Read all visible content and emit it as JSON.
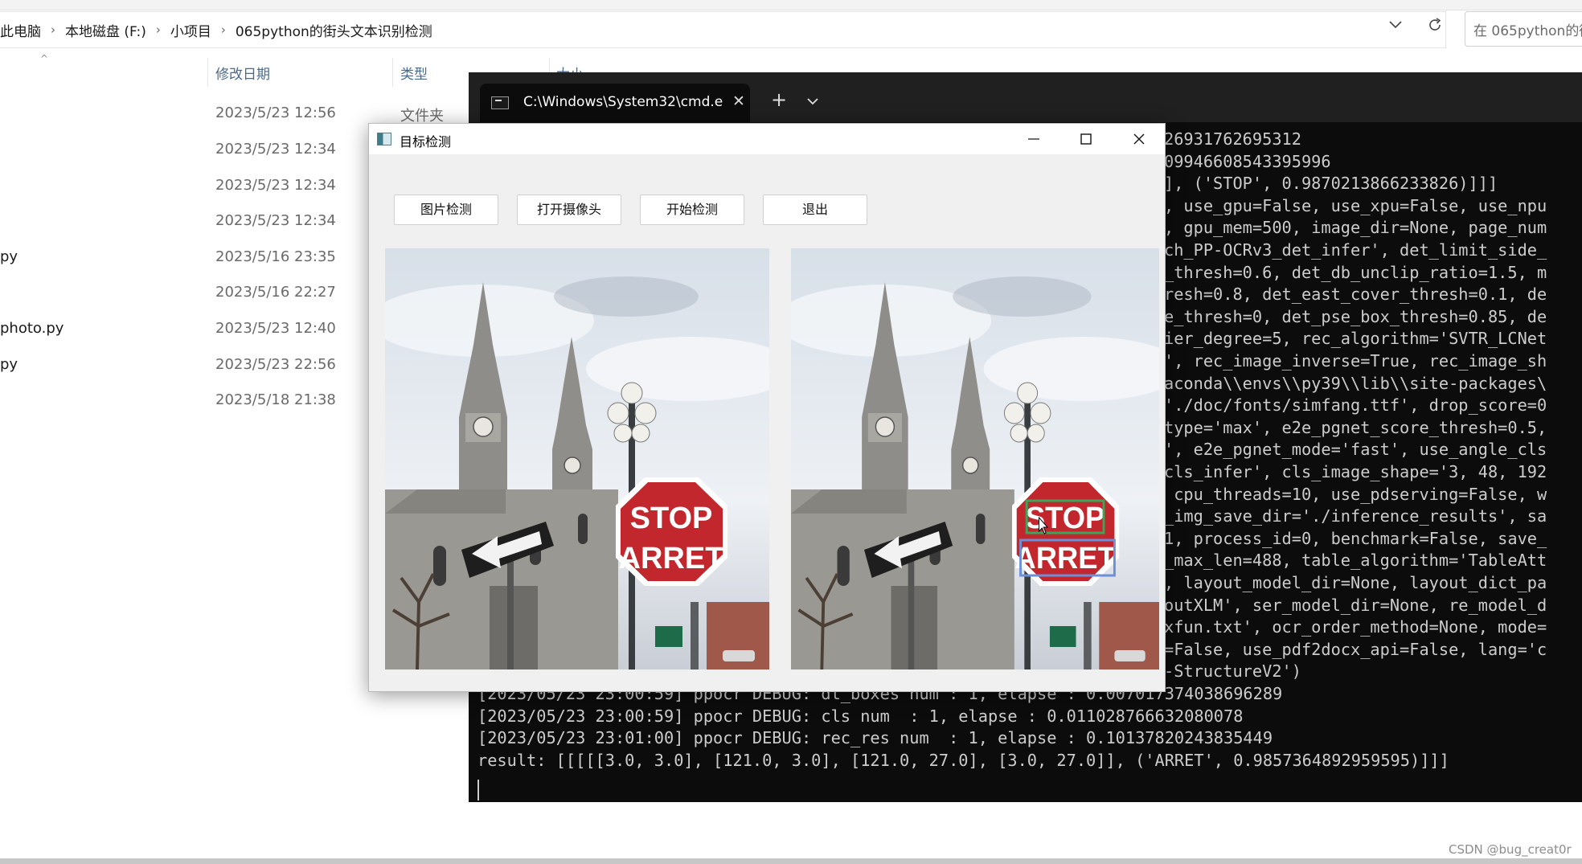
{
  "explorer": {
    "breadcrumb": [
      "此电脑",
      "本地磁盘 (F:)",
      "小项目",
      "065python的街头文本识别检测"
    ],
    "search_placeholder": "在 065python的街",
    "columns": {
      "date": "修改日期",
      "type": "类型",
      "size": "大小"
    },
    "rows": [
      {
        "name": "",
        "date": "2023/5/23 12:56",
        "type": "文件夹"
      },
      {
        "name": "",
        "date": "2023/5/23 12:34",
        "type": ""
      },
      {
        "name": "",
        "date": "2023/5/23 12:34",
        "type": ""
      },
      {
        "name": "",
        "date": "2023/5/23 12:34",
        "type": ""
      },
      {
        "name": "py",
        "date": "2023/5/16 23:35",
        "type": ""
      },
      {
        "name": "",
        "date": "2023/5/16 22:27",
        "type": ""
      },
      {
        "name": "photo.py",
        "date": "2023/5/23 12:40",
        "type": ""
      },
      {
        "name": "py",
        "date": "2023/5/23 22:56",
        "type": ""
      },
      {
        "name": "",
        "date": "2023/5/18 21:38",
        "type": ""
      }
    ]
  },
  "terminal": {
    "tab_title": "C:\\Windows\\System32\\cmd.e",
    "visible_right_lines": [
      "26931762695312",
      "09946608543395996",
      "], ('STOP', 0.9870213866233826)]]]",
      ", use_gpu=False, use_xpu=False, use_npu",
      ", gpu_mem=500, image_dir=None, page_num",
      "ch_PP-OCRv3_det_infer', det_limit_side_",
      "_thresh=0.6, det_db_unclip_ratio=1.5, m",
      "resh=0.8, det_east_cover_thresh=0.1, de",
      "e_thresh=0, det_pse_box_thresh=0.85, de",
      "ier_degree=5, rec_algorithm='SVTR_LCNet",
      "', rec_image_inverse=True, rec_image_sh",
      "aconda\\\\envs\\\\py39\\\\lib\\\\site-packages\\",
      "'./doc/fonts/simfang.ttf', drop_score=0",
      "type='max', e2e_pgnet_score_thresh=0.5,",
      "', e2e_pgnet_mode='fast', use_angle_cls",
      "cls_infer', cls_image_shape='3, 48, 192",
      " cpu_threads=10, use_pdserving=False, w",
      "_img_save_dir='./inference_results', sa",
      "1, process_id=0, benchmark=False, save_",
      "_max_len=488, table_algorithm='TableAtt",
      ", layout_model_dir=None, layout_dict_pa",
      "outXLM', ser_model_dir=None, re_model_d",
      "xfun.txt', ocr_order_method=None, mode=",
      "=False, use_pdf2docx_api=False, lang='c",
      "-StructureV2')"
    ],
    "bottom_lines": [
      "[2023/05/23 23:00:59] ppocr DEBUG: dt_boxes num : 1, elapse : 0.007017374038696289",
      "[2023/05/23 23:00:59] ppocr DEBUG: cls num  : 1, elapse : 0.011028766632080078",
      "[2023/05/23 23:01:00] ppocr DEBUG: rec_res num  : 1, elapse : 0.10137820243835449",
      "result: [[[[[3.0, 3.0], [121.0, 3.0], [121.0, 27.0], [3.0, 27.0]], ('ARRET', 0.9857364892959595)]]]"
    ]
  },
  "app": {
    "title": "目标检测",
    "buttons": [
      "图片检测",
      "打开摄像头",
      "开始检测",
      "退出"
    ],
    "sign_words": [
      "STOP",
      "ARRET"
    ],
    "detected_labels": [
      "STOP",
      "ARRET"
    ]
  },
  "watermark": "CSDN @bug_creat0r",
  "colors": {
    "terminal_bg": "#0c0c0c",
    "terminal_text": "#cccccc",
    "stop_red": "#c2272d",
    "box_green": "#3aa65a",
    "box_blue": "#6c8fd8"
  }
}
